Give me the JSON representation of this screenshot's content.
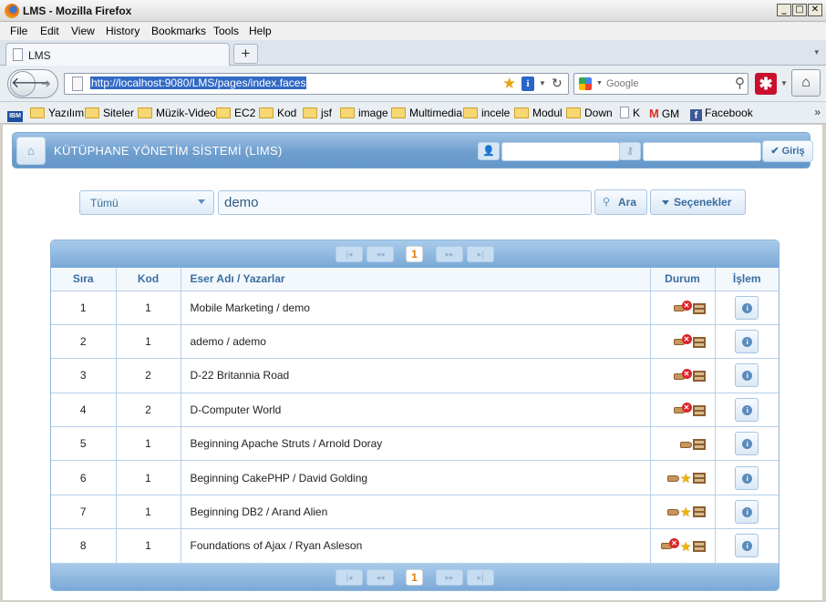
{
  "window": {
    "title": "LMS - Mozilla Firefox"
  },
  "menu": [
    "File",
    "Edit",
    "View",
    "History",
    "Bookmarks",
    "Tools",
    "Help"
  ],
  "tab": {
    "label": "LMS",
    "new_tab": "+"
  },
  "navigation": {
    "url": "http://localhost:9080/LMS/pages/index.faces",
    "search_placeholder": "Google"
  },
  "bookmarks": [
    "Yazılım",
    "Siteler",
    "Müzik-Video",
    "EC2",
    "Kod",
    "jsf",
    "image",
    "Multimedia",
    "incele",
    "Modul",
    "Down",
    "K",
    "GM",
    "Facebook"
  ],
  "app": {
    "title": "KÜTÜPHANE YÖNETİM SİSTEMİ (LIMS)",
    "login_label": "Giriş",
    "user_value": "",
    "password_value": ""
  },
  "search": {
    "category": "Tümü",
    "query": "demo",
    "search_label": "Ara",
    "options_label": "Seçenekler"
  },
  "pager": {
    "current_page": "1",
    "first": "|◂",
    "prev": "◂◂",
    "next": "▸▸",
    "last": "▸|"
  },
  "table": {
    "columns": [
      "Sıra",
      "Kod",
      "Eser Adı / Yazarlar",
      "Durum",
      "İşlem"
    ],
    "rows": [
      {
        "sira": "1",
        "kod": "1",
        "eser": "Mobile Marketing / demo",
        "status_icons": [
          "hand-icon",
          "red-x-icon",
          "shelf-icon"
        ]
      },
      {
        "sira": "2",
        "kod": "1",
        "eser": "ademo / ademo",
        "status_icons": [
          "hand-icon",
          "red-x-icon",
          "shelf-icon"
        ]
      },
      {
        "sira": "3",
        "kod": "2",
        "eser": "D-22 Britannia Road",
        "status_icons": [
          "hand-icon",
          "red-x-icon",
          "shelf-icon"
        ]
      },
      {
        "sira": "4",
        "kod": "2",
        "eser": "D-Computer World",
        "status_icons": [
          "hand-icon",
          "red-x-icon",
          "shelf-icon"
        ]
      },
      {
        "sira": "5",
        "kod": "1",
        "eser": "Beginning Apache Struts / Arnold Doray",
        "status_icons": [
          "hand-icon",
          "shelf-icon"
        ]
      },
      {
        "sira": "6",
        "kod": "1",
        "eser": "Beginning CakePHP / David Golding",
        "status_icons": [
          "hand-icon",
          "star-icon",
          "shelf-icon"
        ]
      },
      {
        "sira": "7",
        "kod": "1",
        "eser": "Beginning DB2 / Arand Alien",
        "status_icons": [
          "hand-icon",
          "star-icon",
          "shelf-icon"
        ]
      },
      {
        "sira": "8",
        "kod": "1",
        "eser": "Foundations of Ajax / Ryan Asleson",
        "status_icons": [
          "hand-icon",
          "red-x-icon",
          "star-icon",
          "shelf-icon"
        ]
      }
    ]
  },
  "colors": {
    "header_blue": "#6f9fce",
    "accent_text": "#3b6da1",
    "page_number": "#e07a14"
  }
}
